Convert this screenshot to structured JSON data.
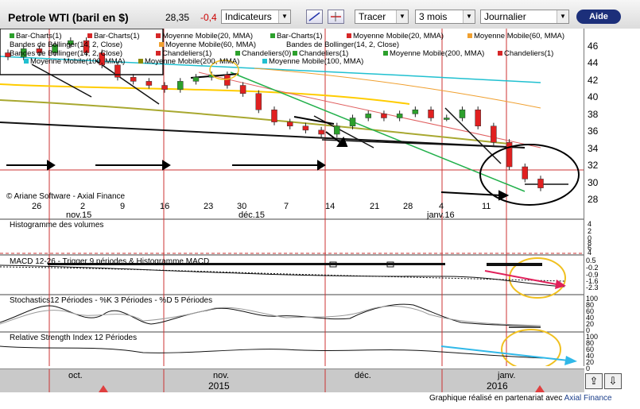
{
  "toolbar": {
    "title": "Petrole WTI (baril en $)",
    "price": "28,35",
    "change": "-0,4",
    "indicators_label": "Indicateurs",
    "draw_label": "Tracer",
    "period_label": "3 mois",
    "frequency_label": "Journalier",
    "help_label": "Aide"
  },
  "legend": {
    "items": [
      {
        "label": "Bar-Charts(1)",
        "color": "#2ca02c"
      },
      {
        "label": "Bar-Charts(1)",
        "color": "#d62728"
      },
      {
        "label": "Moyenne Mobile(20, MMA)",
        "color": "#d62728"
      },
      {
        "label": "Bar-Charts(1)",
        "color": "#2ca02c"
      },
      {
        "label": "Moyenne Mobile(20, MMA)",
        "color": "#d62728"
      },
      {
        "label": "Moyenne Mobile(60, MMA)",
        "color": "#f0a030"
      },
      {
        "label": "Bandes de Bollinger(14, 2, Close)",
        "color": "#222222"
      },
      {
        "label": "Moyenne Mobile(60, MMA)",
        "color": "#f0a030"
      },
      {
        "label": "Bandes de Bollinger(14, 2, Close)",
        "color": "#222222"
      },
      {
        "label": "Bandes de Bollinger(14, 2, Close)",
        "color": "#222222"
      },
      {
        "label": "Chandeliers(1)",
        "color": "#d62728"
      },
      {
        "label": "Chandeliers(0)",
        "color": "#2ca02c"
      },
      {
        "label": "Chandeliers(1)",
        "color": "#2ca02c"
      },
      {
        "label": "Moyenne Mobile(200, MMA)",
        "color": "#2ca02c"
      },
      {
        "label": "Chandeliers(1)",
        "color": "#d62728"
      },
      {
        "label": "Moyenne Mobile(100, MMA)",
        "color": "#20c0d0"
      },
      {
        "label": "Moyenne Mobile(200, MMA)",
        "color": "#8a8a00"
      },
      {
        "label": "Moyenne Mobile(100, MMA)",
        "color": "#20c0d0"
      }
    ]
  },
  "copyright": "© Ariane Software - Axial Finance",
  "price_axis": [
    "46",
    "44",
    "42",
    "40",
    "38",
    "36",
    "34",
    "32",
    "30",
    "28"
  ],
  "dates": {
    "days": [
      "26",
      "2",
      "9",
      "16",
      "23",
      "30",
      "7",
      "14",
      "21",
      "28",
      "4",
      "11"
    ],
    "months": [
      "nov.15",
      "déc.15",
      "janv.16"
    ]
  },
  "panes": {
    "volume_label": "Histogramme des volumes",
    "volume_axis": [
      "4",
      "2",
      "0",
      "8",
      "6",
      "4",
      "2",
      "0"
    ],
    "macd_label": "MACD 12-26 - Trigger 9 périodes & Histogramme MACD",
    "macd_axis": [
      "0.5",
      "-0.2",
      "-0.9",
      "-1.6",
      "-2.3"
    ],
    "stoch_label": "Stochastics12 Périodes  -  %K 3 Périodes  -  %D 5 Périodes",
    "stoch_axis": [
      "100",
      "80",
      "60",
      "40",
      "20",
      "0"
    ],
    "rsi_label": "Relative Strength Index 12 Périodes",
    "rsi_axis": [
      "100",
      "80",
      "60",
      "40",
      "20",
      "0"
    ]
  },
  "navigator": {
    "months": [
      "oct.",
      "nov.",
      "déc.",
      "janv."
    ],
    "years": [
      "2015",
      "2016"
    ]
  },
  "footer": {
    "text": "Graphique réalisé en partenariat avec",
    "link": "Axial Finance"
  },
  "chart_data": {
    "type": "candlestick",
    "title": "Petrole WTI (baril en $)",
    "ylim": [
      27,
      47
    ],
    "categories": [
      "oct.15",
      "",
      "",
      "",
      "",
      "",
      "",
      "nov.15",
      "",
      "",
      "",
      "",
      "",
      "",
      "",
      "",
      "",
      "déc.15",
      "",
      "",
      "",
      "",
      "",
      "",
      "",
      "",
      "",
      "",
      "janv.16",
      "",
      "",
      "",
      "",
      ""
    ],
    "series": [
      {
        "name": "Chandeliers",
        "values": [
          44.5,
          45.5,
          45,
          46,
          46.5,
          45,
          43.5,
          42,
          41.5,
          41,
          40.5,
          41.5,
          42,
          42.3,
          41,
          40,
          38,
          36.5,
          36,
          35.5,
          35,
          36,
          37,
          37.5,
          37,
          37.5,
          38,
          37,
          37,
          38,
          36,
          34,
          31,
          29.5,
          28.4
        ]
      }
    ]
  }
}
